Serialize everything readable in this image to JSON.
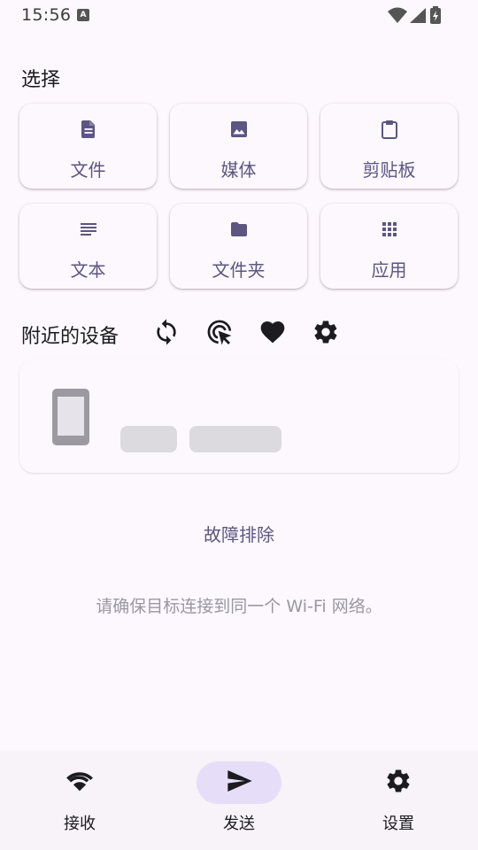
{
  "status_bar": {
    "time": "15:56",
    "notification_badge": "A"
  },
  "select": {
    "title": "选择",
    "items": [
      {
        "label": "文件",
        "icon": "file-icon"
      },
      {
        "label": "媒体",
        "icon": "image-icon"
      },
      {
        "label": "剪贴板",
        "icon": "clipboard-icon"
      },
      {
        "label": "文本",
        "icon": "text-icon"
      },
      {
        "label": "文件夹",
        "icon": "folder-icon"
      },
      {
        "label": "应用",
        "icon": "apps-icon"
      }
    ]
  },
  "nearby": {
    "title": "附近的设备",
    "actions": [
      "refresh-icon",
      "target-cursor-icon",
      "heart-icon",
      "gear-icon"
    ]
  },
  "troubleshoot_label": "故障排除",
  "hint_text": "请确保目标连接到同一个 Wi-Fi 网络。",
  "nav": {
    "items": [
      {
        "label": "接收",
        "icon": "wifi-icon",
        "active": false
      },
      {
        "label": "发送",
        "icon": "send-icon",
        "active": true
      },
      {
        "label": "设置",
        "icon": "gear-icon",
        "active": false
      }
    ]
  },
  "colors": {
    "accent": "#5d5582",
    "background": "#fdf8fd",
    "nav_active": "#e6def8"
  }
}
